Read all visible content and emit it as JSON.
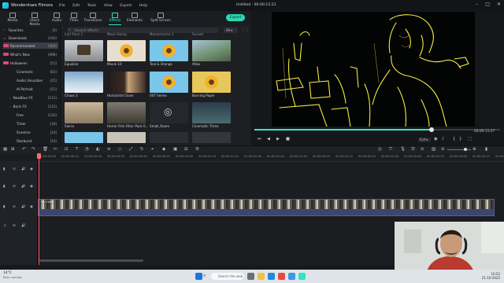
{
  "app": {
    "name": "Wondershare Filmora",
    "menu": [
      "File",
      "Edit",
      "Tools",
      "View",
      "Export",
      "Help"
    ],
    "doc_title": "Untitled : 00:00:12:21"
  },
  "top_tabs": [
    "Media",
    "Stock Media",
    "Audio",
    "Titles",
    "Transitions",
    "Effects",
    "Elements",
    "Split Screen"
  ],
  "active_tab": "Effects",
  "export_label": "Export",
  "sidebar": {
    "items": [
      {
        "label": "Favorites",
        "count": "(0)"
      },
      {
        "label": "Downloads",
        "count": "(194)"
      },
      {
        "label": "Recommended",
        "count": "(500)",
        "active": true,
        "badge": true
      },
      {
        "label": "What's New",
        "count": "(996)",
        "badge": true
      },
      {
        "label": "Halloween",
        "count": "(51)",
        "badge": true
      },
      {
        "label": "Cinematic",
        "count": "(83)"
      },
      {
        "label": "Audio Visualizer",
        "count": "(25)"
      },
      {
        "label": "AI Portrait",
        "count": "(51)"
      },
      {
        "label": "NewBlue FX",
        "count": "(112)"
      },
      {
        "label": "Boris FX",
        "count": "(122)"
      },
      {
        "label": "Free",
        "count": "(120)"
      },
      {
        "label": "Timer",
        "count": "(34)"
      },
      {
        "label": "Scanline",
        "count": "(24)"
      },
      {
        "label": "Starburst",
        "count": "(24)"
      }
    ]
  },
  "effects": {
    "search_placeholder": "Search effects",
    "filter_value": "All",
    "top_row_labels": [
      "Carl Fenn 1",
      "Moon Swing",
      "Monochrome 1",
      "Sunset"
    ],
    "tiles": [
      {
        "label": "Equalize"
      },
      {
        "label": "Movie 10"
      },
      {
        "label": "Teal & Orange"
      },
      {
        "label": "Atlas"
      },
      {
        "label": "Chaos 3"
      },
      {
        "label": "Horizontal Close"
      },
      {
        "label": "007 Series"
      },
      {
        "label": "Burning Paper"
      },
      {
        "label": "Sierra"
      },
      {
        "label": "Horror Film Filter Pack 0..."
      },
      {
        "label": "Small_Room"
      },
      {
        "label": "Cinematic Three"
      }
    ]
  },
  "preview": {
    "timecode": "00:00:11:27",
    "progress": 0.72,
    "quality": "Full"
  },
  "timeline": {
    "ticks": [
      "00:00:00:00",
      "00:00:00:10",
      "00:00:00:20",
      "00:00:00:30",
      "00:00:00:40",
      "00:00:00:50",
      "00:00:01:00",
      "00:00:01:10",
      "00:00:01:20",
      "00:00:01:30",
      "00:00:01:40",
      "00:00:01:50",
      "00:00:02:00",
      "00:00:02:10",
      "00:00:02:20",
      "00:00:02:30",
      "00:00:02:40",
      "00:00:02:50",
      "00:00:03:00",
      "00:00:03:10",
      "00:00:03:20"
    ],
    "clip_name": "My Video"
  },
  "taskbar": {
    "weather_temp": "14°C",
    "weather_desc": "Rain coming",
    "search_placeholder": "Search the web",
    "time": "10:52",
    "date": "21-10-2022"
  },
  "colors": {
    "accent": "#2ee6c5",
    "badge": "#e0496b",
    "clip": "#3c4470"
  }
}
